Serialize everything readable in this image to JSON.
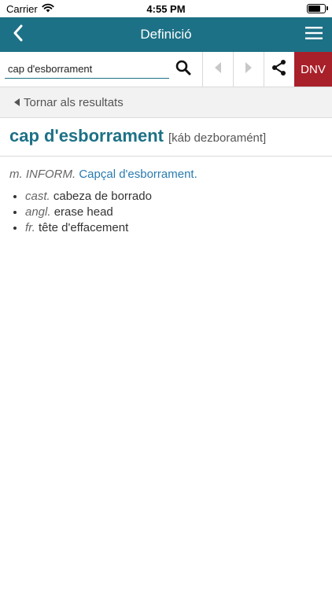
{
  "status": {
    "carrier": "Carrier",
    "time": "4:55 PM",
    "battery_level": 0.85
  },
  "nav": {
    "title": "Definició",
    "back_icon": "chevron-left-icon",
    "menu_icon": "hamburger-icon"
  },
  "search": {
    "value": "cap d'esborrament",
    "placeholder": ""
  },
  "toolbar": {
    "dnv_label": "DNV"
  },
  "back_to_results": "Tornar als resultats",
  "entry": {
    "headword": "cap d'esborrament",
    "pronunciation": "[káb dezboramént]",
    "grammar": "m. INFORM.",
    "definition_link": "Capçal d'esborrament.",
    "translations": [
      {
        "lang": "cast.",
        "text": "cabeza de borrado"
      },
      {
        "lang": "angl.",
        "text": "erase head"
      },
      {
        "lang": "fr.",
        "text": "tête d'effacement"
      }
    ]
  },
  "colors": {
    "nav_bg": "#1d7186",
    "dnv_bg": "#a8202a",
    "link": "#2a7bb0"
  }
}
